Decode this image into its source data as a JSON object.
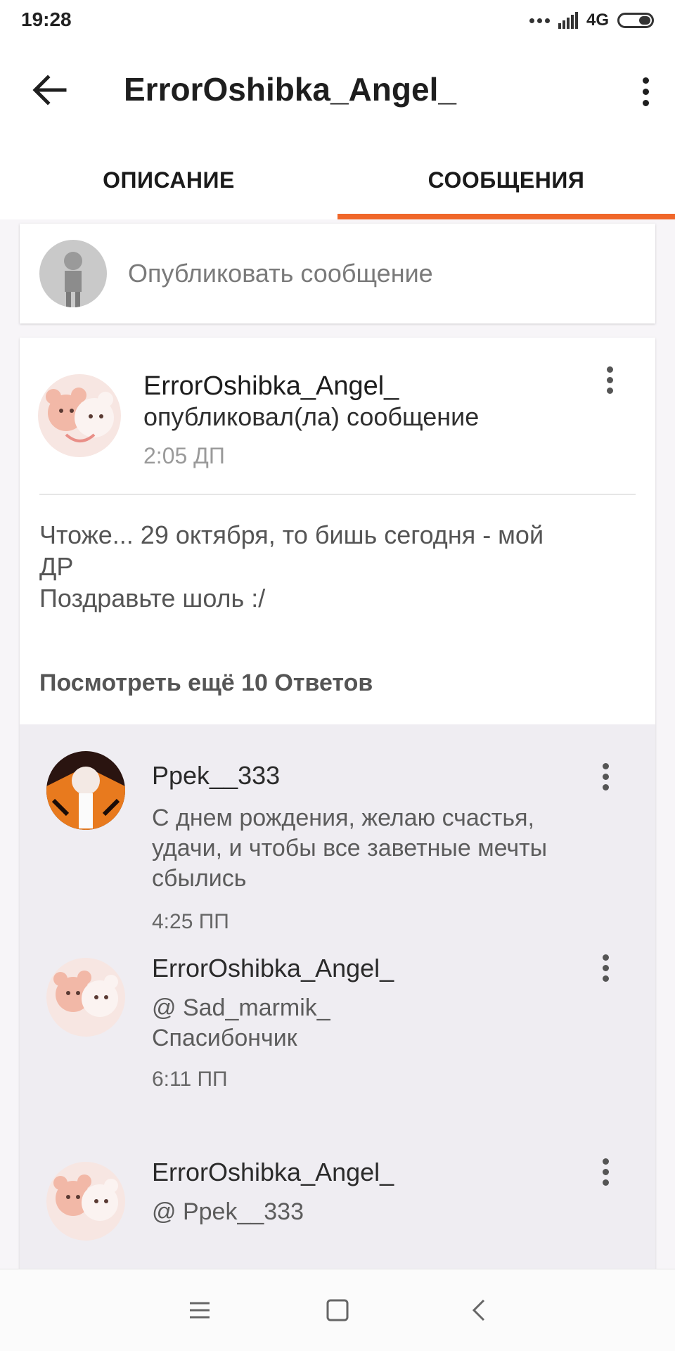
{
  "status_bar": {
    "time": "19:28",
    "network": "4G"
  },
  "app_bar": {
    "title": "ErrorOshibka_Angel_"
  },
  "tabs": [
    {
      "label": "ОПИСАНИЕ",
      "active": false
    },
    {
      "label": "СООБЩЕНИЯ",
      "active": true
    }
  ],
  "composer": {
    "placeholder": "Опубликовать сообщение"
  },
  "post": {
    "author": "ErrorOshibka_Angel_",
    "action": "опубликовал(ла) сообщение",
    "time": "2:05 ДП",
    "body_lines": [
      "Чтоже... 29 октября, то бишь сегодня - мой",
      "ДР",
      "Поздравьте шоль :/"
    ],
    "more_replies": "Посмотреть ещё 10 Ответов"
  },
  "replies": [
    {
      "author": "Ppek__333",
      "text_lines": [
        "С днем рождения, желаю счастья,",
        "удачи, и чтобы  все заветные мечты",
        "сбылись"
      ],
      "time": "4:25 ПП"
    },
    {
      "author": "ErrorOshibka_Angel_",
      "text_lines": [
        "@ Sad_marmik_",
        "Спасибончик"
      ],
      "time": "6:11 ПП"
    },
    {
      "author": "ErrorOshibka_Angel_",
      "text_lines": [
        "@ Ppek__333"
      ],
      "time": ""
    }
  ],
  "colors": {
    "accent": "#f0672a",
    "reply_background": "#efedf2"
  },
  "icons": [
    "back-arrow-icon",
    "more-vert-icon",
    "nav-menu-icon",
    "nav-home-icon",
    "nav-back-icon"
  ]
}
